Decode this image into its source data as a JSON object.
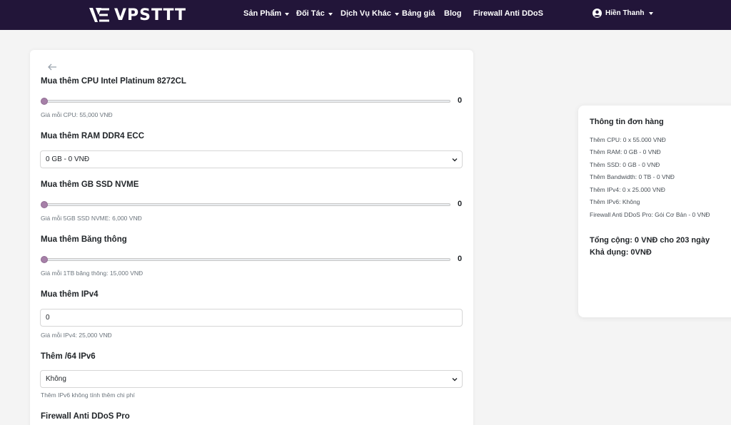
{
  "brand": {
    "name": "VPSTTT"
  },
  "nav": {
    "items": [
      {
        "label": "Sản Phẩm",
        "dropdown": true
      },
      {
        "label": "Đối Tác",
        "dropdown": true
      },
      {
        "label": "Dịch Vụ Khác",
        "dropdown": true
      },
      {
        "label": "Bảng giá",
        "dropdown": false
      },
      {
        "label": "Blog",
        "dropdown": false
      },
      {
        "label": "Firewall Anti DDoS",
        "dropdown": false
      }
    ],
    "user": "Hiền Thanh"
  },
  "form": {
    "cpu": {
      "label": "Mua thêm CPU Intel Platinum 8272CL",
      "value": "0",
      "hint": "Giá mỗi CPU: 55,000 VNĐ"
    },
    "ram": {
      "label": "Mua thêm RAM DDR4 ECC",
      "selected": "0 GB - 0 VNĐ"
    },
    "ssd": {
      "label": "Mua thêm GB SSD NVME",
      "value": "0",
      "hint": "Giá mỗi 5GB SSD NVME: 6,000 VNĐ"
    },
    "bandwidth": {
      "label": "Mua thêm Băng thông",
      "value": "0",
      "hint": "Giá mỗi 1TB băng thông: 15,000 VNĐ"
    },
    "ipv4": {
      "label": "Mua thêm IPv4",
      "value": "0",
      "hint": "Giá mỗi IPv4: 25,000 VNĐ"
    },
    "ipv6": {
      "label": "Thêm /64 IPv6",
      "selected": "Không",
      "hint": "Thêm IPv6 không tính thêm chi phí"
    },
    "firewall": {
      "label": "Firewall Anti DDoS Pro"
    }
  },
  "order": {
    "title": "Thông tin đơn hàng",
    "lines": [
      "Thêm CPU: 0 x 55.000 VNĐ",
      "Thêm RAM: 0 GB - 0 VNĐ",
      "Thêm SSD: 0 GB - 0 VNĐ",
      "Thêm Bandwidth: 0 TB - 0 VNĐ",
      "Thêm IPv4: 0 x 25.000 VNĐ",
      "Thêm IPv6: Không",
      "Firewall Anti DDoS Pro: Gói Cơ Bản - 0 VNĐ"
    ],
    "total": "Tổng cộng: 0 VNĐ cho 203 ngày",
    "available": "Khả dụng: 0VNĐ"
  },
  "colors": {
    "navbar": "#221539",
    "slider_thumb": "#a680a8"
  }
}
